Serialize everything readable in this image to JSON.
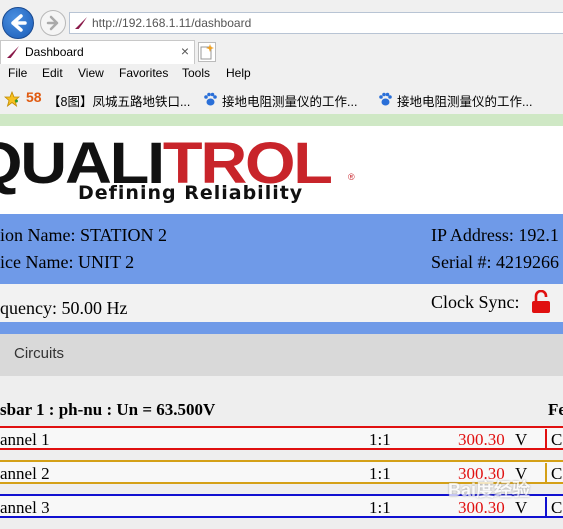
{
  "browser": {
    "url": "http://192.168.1.11/dashboard",
    "tab_title": "Dashboard",
    "tab_close": "×",
    "menu": [
      "File",
      "Edit",
      "View",
      "Favorites",
      "Tools",
      "Help"
    ],
    "favorites": [
      {
        "icon": "58-logo-icon",
        "label": "【8图】凤城五路地铁口..."
      },
      {
        "icon": "baidu-paw-icon",
        "label": "接地电阻测量仪的工作..."
      },
      {
        "icon": "baidu-paw-icon",
        "label": "接地电阻测量仪的工作..."
      }
    ],
    "fav_58_text": "58"
  },
  "brand": {
    "logo_main": "QUALI",
    "logo_red": "TROL",
    "tagline": "Defining Reliability",
    "reg_mark": "®",
    "red_color": "#c8242a"
  },
  "station": {
    "station_name": "ion Name: STATION 2",
    "device_name": "ice Name: UNIT 2",
    "ip_address": "IP Address: 192.1",
    "serial": "Serial #: 4219266",
    "frequency": "quency: 50.00 Hz",
    "clock_sync": "Clock Sync:",
    "lock_color": "#e01010"
  },
  "circuits": {
    "label": "Circuits",
    "busbar_header": "sbar 1 : ph-nu : Un = 63.500V",
    "right_header": "Fe",
    "channels": [
      {
        "name": "annel 1",
        "ratio": "1:1",
        "value": "300.30",
        "unit": "V",
        "col": "C",
        "color": "#e01010"
      },
      {
        "name": "annel 2",
        "ratio": "1:1",
        "value": "300.30",
        "unit": "V",
        "col": "C",
        "color": "#d4a017"
      },
      {
        "name": "annel 3",
        "ratio": "1:1",
        "value": "300.30",
        "unit": "V",
        "col": "C",
        "color": "#1010d0"
      }
    ]
  },
  "watermark": "Bai度经验"
}
